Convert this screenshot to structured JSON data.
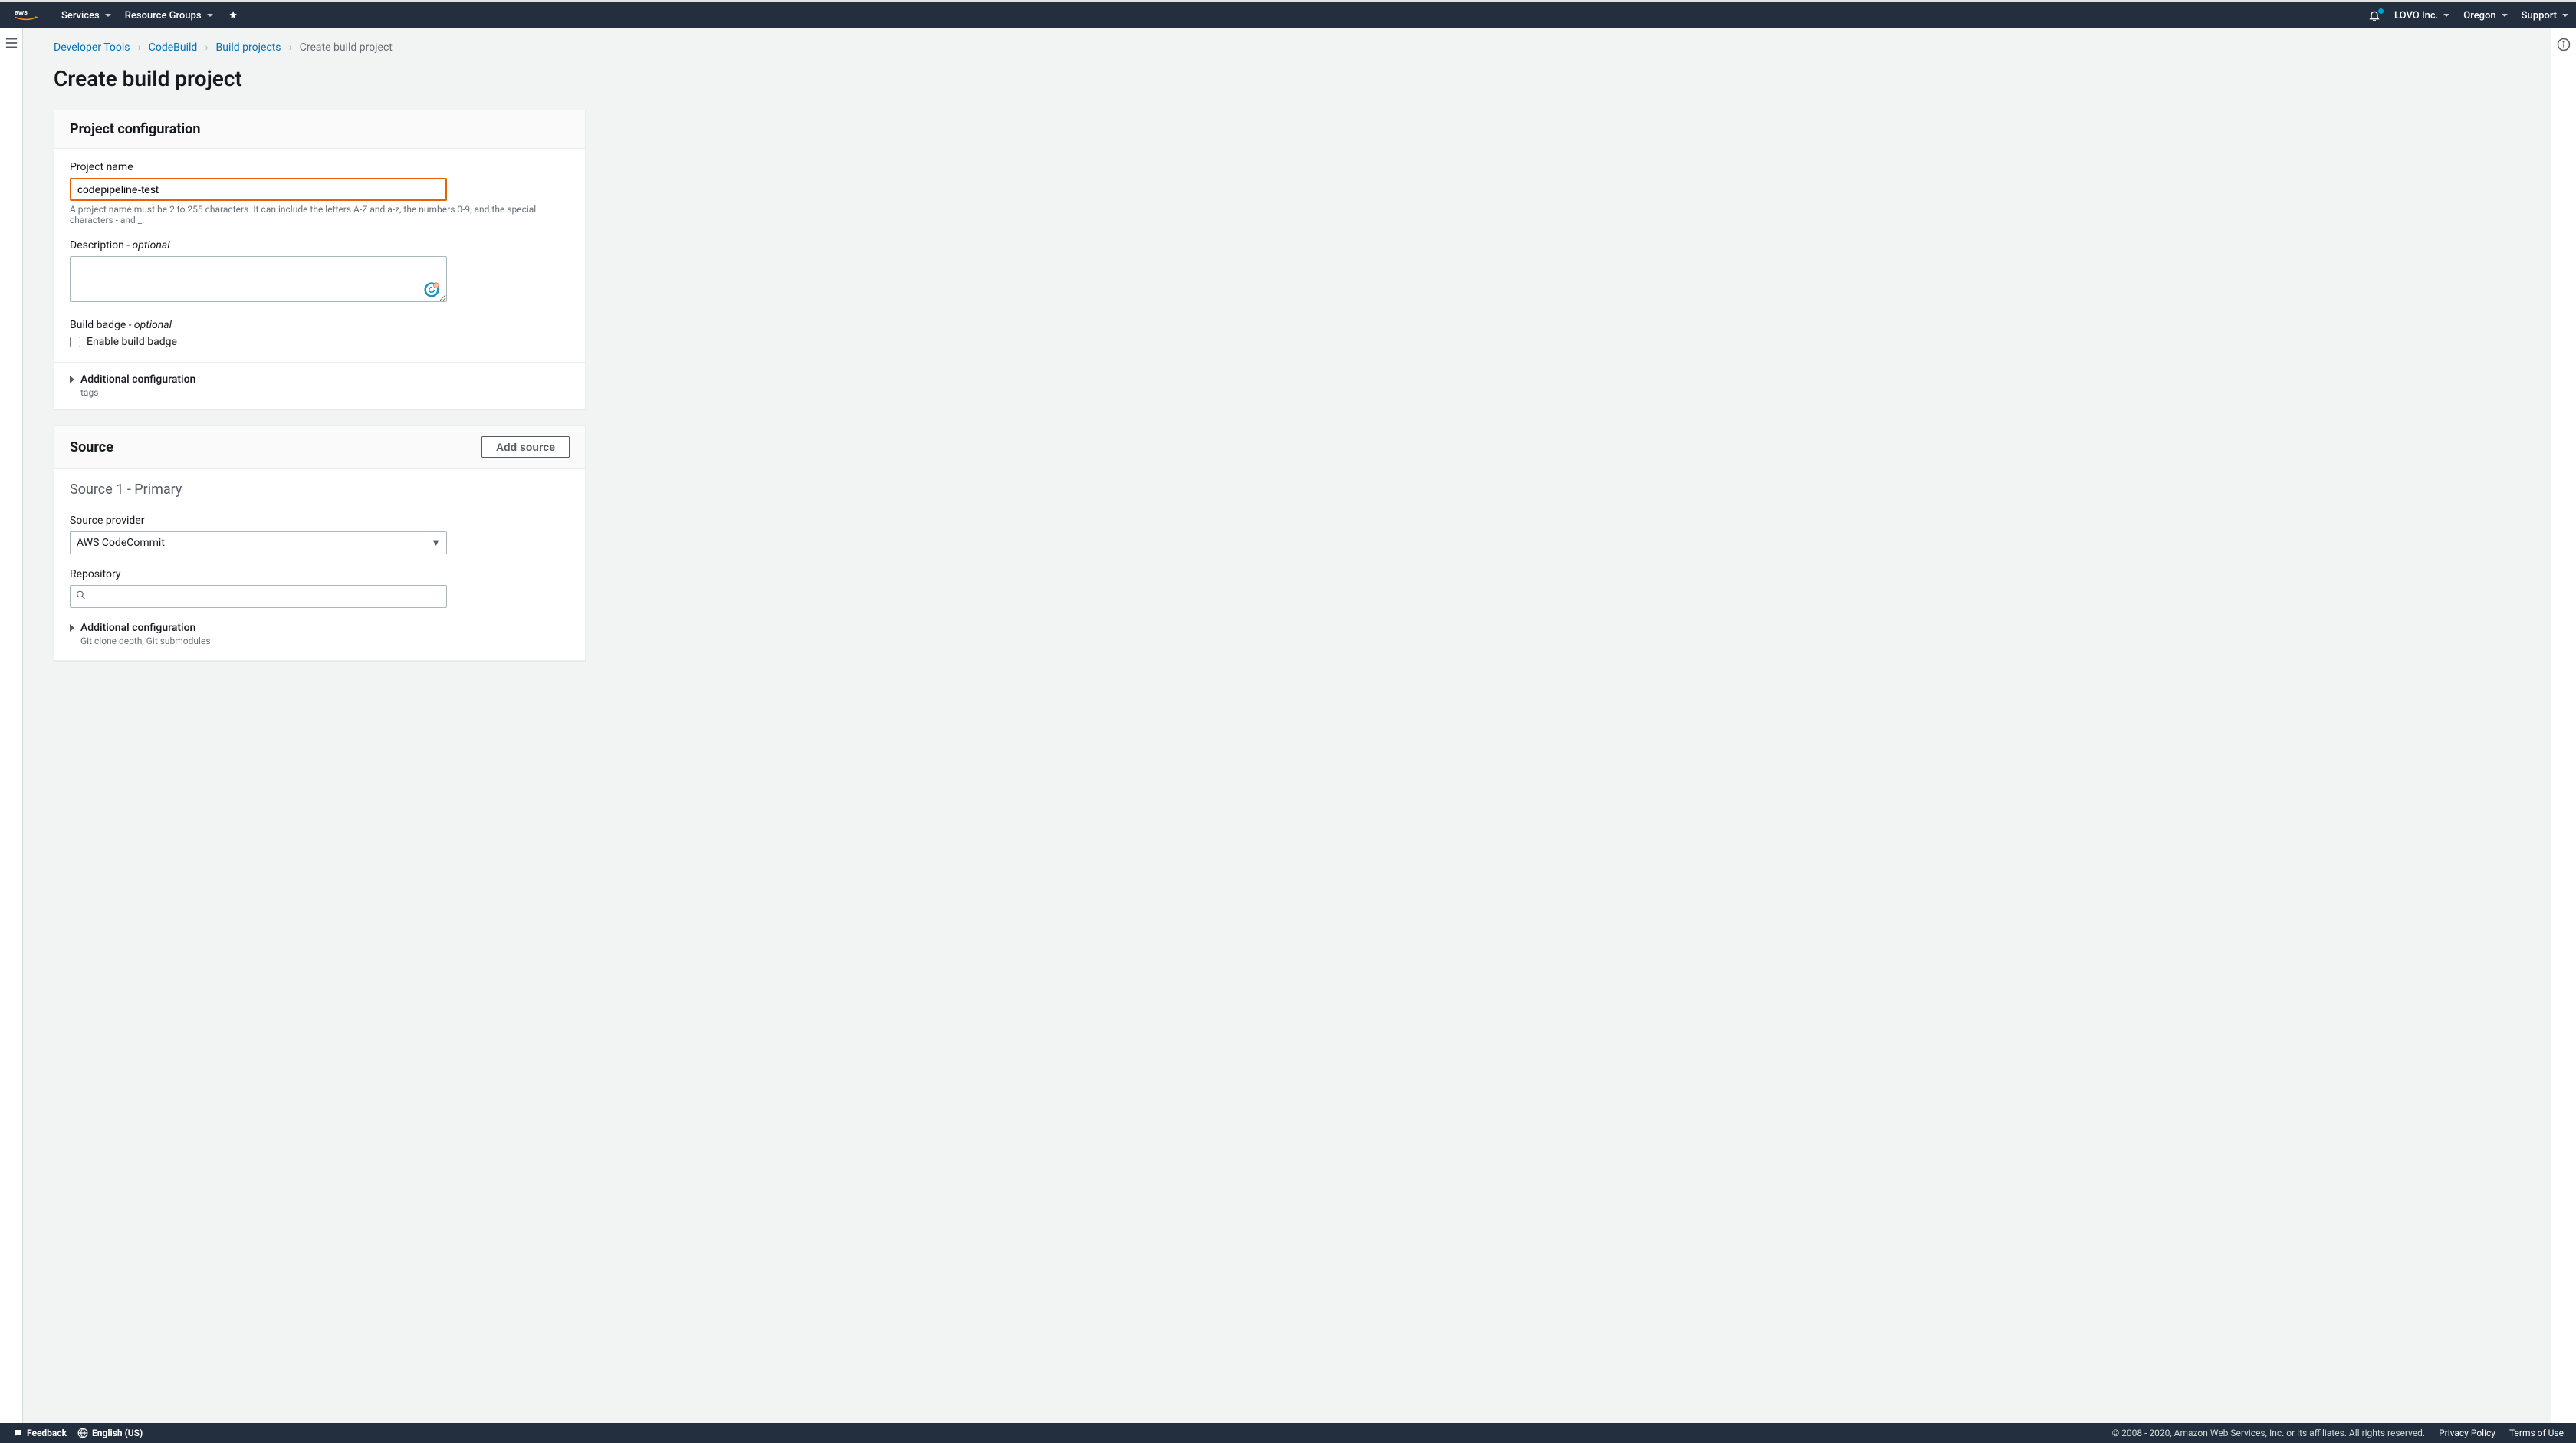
{
  "header": {
    "services": "Services",
    "resource_groups": "Resource Groups",
    "account": "LOVO Inc.",
    "region": "Oregon",
    "support": "Support"
  },
  "breadcrumbs": {
    "dev_tools": "Developer Tools",
    "codebuild": "CodeBuild",
    "build_projects": "Build projects",
    "current": "Create build project"
  },
  "page_title": "Create build project",
  "project_config": {
    "panel_title": "Project configuration",
    "project_name_label": "Project name",
    "project_name_value": "codepipeline-test",
    "project_name_hint": "A project name must be 2 to 255 characters. It can include the letters A-Z and a-z, the numbers 0-9, and the special characters - and _.",
    "description_label": "Description",
    "description_optional": " - optional",
    "description_value": "",
    "build_badge_label": "Build badge",
    "build_badge_optional": " - optional",
    "build_badge_checkbox": "Enable build badge",
    "additional_button": "Additional configuration",
    "additional_sub": "tags"
  },
  "source": {
    "panel_title": "Source",
    "add_source": "Add source",
    "subheader": "Source 1 - Primary",
    "provider_label": "Source provider",
    "provider_value": "AWS CodeCommit",
    "repository_label": "Repository",
    "repository_value": "",
    "additional_button": "Additional configuration",
    "additional_sub": "Git clone depth, Git submodules"
  },
  "footer": {
    "feedback": "Feedback",
    "language": "English (US)",
    "copyright": "© 2008 - 2020, Amazon Web Services, Inc. or its affiliates. All rights reserved.",
    "privacy": "Privacy Policy",
    "terms": "Terms of Use"
  }
}
